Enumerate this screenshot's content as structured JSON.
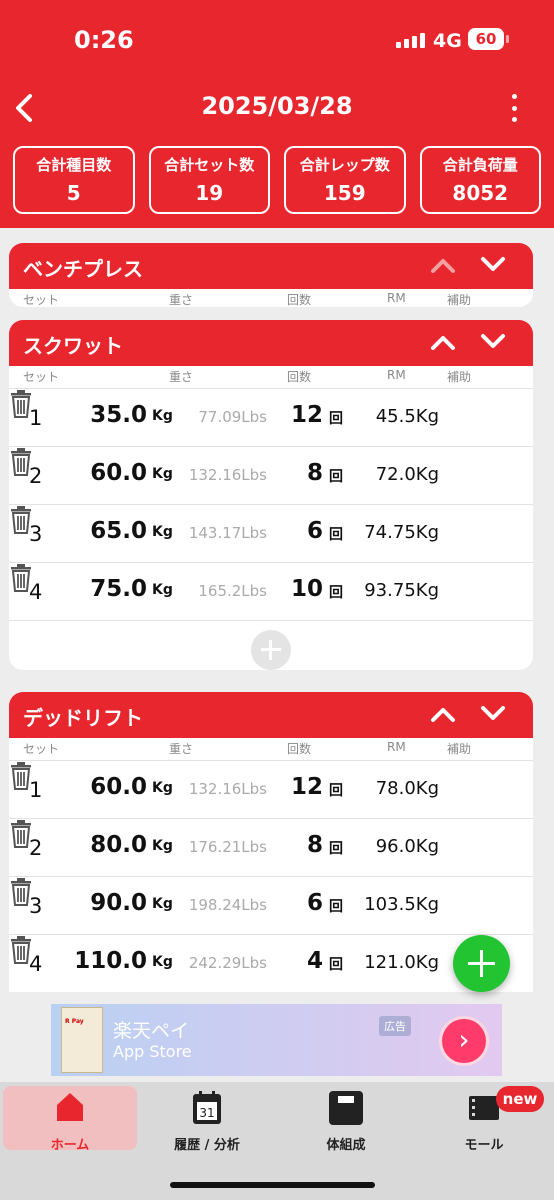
{
  "status": {
    "time": "0:26",
    "network": "4G",
    "battery": "60"
  },
  "header": {
    "title": "2025/03/28"
  },
  "stats": [
    {
      "label": "合計種目数",
      "value": "5"
    },
    {
      "label": "合計セット数",
      "value": "19"
    },
    {
      "label": "合計レップ数",
      "value": "159"
    },
    {
      "label": "合計負荷量",
      "value": "8052"
    }
  ],
  "columns": {
    "set": "セット",
    "weight": "重さ",
    "reps": "回数",
    "rm": "RM",
    "assist": "補助"
  },
  "units": {
    "kg": "Kg",
    "rep": "回"
  },
  "exercises": [
    {
      "name": "ベンチプレス",
      "sets": []
    },
    {
      "name": "スクワット",
      "sets": [
        {
          "set": "1",
          "kg": "35.0",
          "lbs": "77.09Lbs",
          "reps": "12",
          "rm": "45.5Kg"
        },
        {
          "set": "2",
          "kg": "60.0",
          "lbs": "132.16Lbs",
          "reps": "8",
          "rm": "72.0Kg"
        },
        {
          "set": "3",
          "kg": "65.0",
          "lbs": "143.17Lbs",
          "reps": "6",
          "rm": "74.75Kg"
        },
        {
          "set": "4",
          "kg": "75.0",
          "lbs": "165.2Lbs",
          "reps": "10",
          "rm": "93.75Kg"
        }
      ]
    },
    {
      "name": "デッドリフト",
      "sets": [
        {
          "set": "1",
          "kg": "60.0",
          "lbs": "132.16Lbs",
          "reps": "12",
          "rm": "78.0Kg"
        },
        {
          "set": "2",
          "kg": "80.0",
          "lbs": "176.21Lbs",
          "reps": "8",
          "rm": "96.0Kg"
        },
        {
          "set": "3",
          "kg": "90.0",
          "lbs": "198.24Lbs",
          "reps": "6",
          "rm": "103.5Kg"
        },
        {
          "set": "4",
          "kg": "110.0",
          "lbs": "242.29Lbs",
          "reps": "4",
          "rm": "121.0Kg"
        }
      ]
    }
  ],
  "ad": {
    "title": "楽天ペイ",
    "store": "App Store",
    "badge": "広告"
  },
  "tabs": [
    {
      "label": "ホーム",
      "icon": "home-icon"
    },
    {
      "label": "履歴 / 分析",
      "icon": "calendar-icon",
      "day": "31"
    },
    {
      "label": "体組成",
      "icon": "scale-icon"
    },
    {
      "label": "モール",
      "icon": "film-store-icon"
    }
  ],
  "new_badge": "new",
  "colors": {
    "brand_red": "#e8262e",
    "fab_green": "#22c431",
    "tab_bg": "#d9d9d9"
  }
}
